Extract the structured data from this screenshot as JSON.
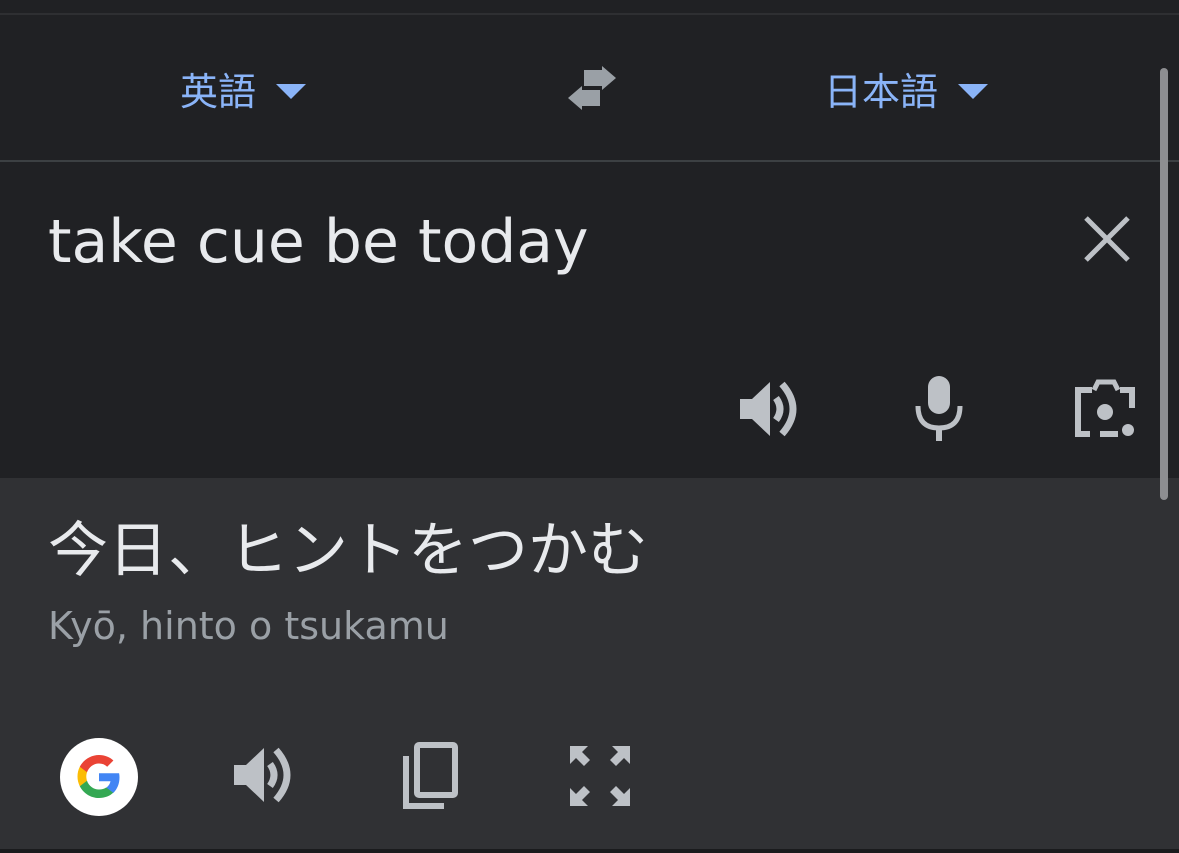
{
  "languages": {
    "source": "英語",
    "target": "日本語"
  },
  "input": {
    "text": "take cue be today"
  },
  "output": {
    "translation": "今日、ヒントをつかむ",
    "romanization": "Kyō, hinto o tsukamu"
  },
  "icons": {
    "swap": "swap-arrows-icon",
    "clear": "close-icon",
    "input_speak": "speaker-icon",
    "mic": "microphone-icon",
    "camera": "camera-lens-icon",
    "google": "google-logo-icon",
    "output_speak": "speaker-icon",
    "copy": "copy-icon",
    "fullscreen": "fullscreen-icon"
  },
  "colors": {
    "accent": "#8ab4f8",
    "background": "#202124",
    "output_background": "#303134",
    "text": "#e8eaed",
    "secondary_text": "#9aa0a6",
    "icon": "#9aa0a6"
  }
}
